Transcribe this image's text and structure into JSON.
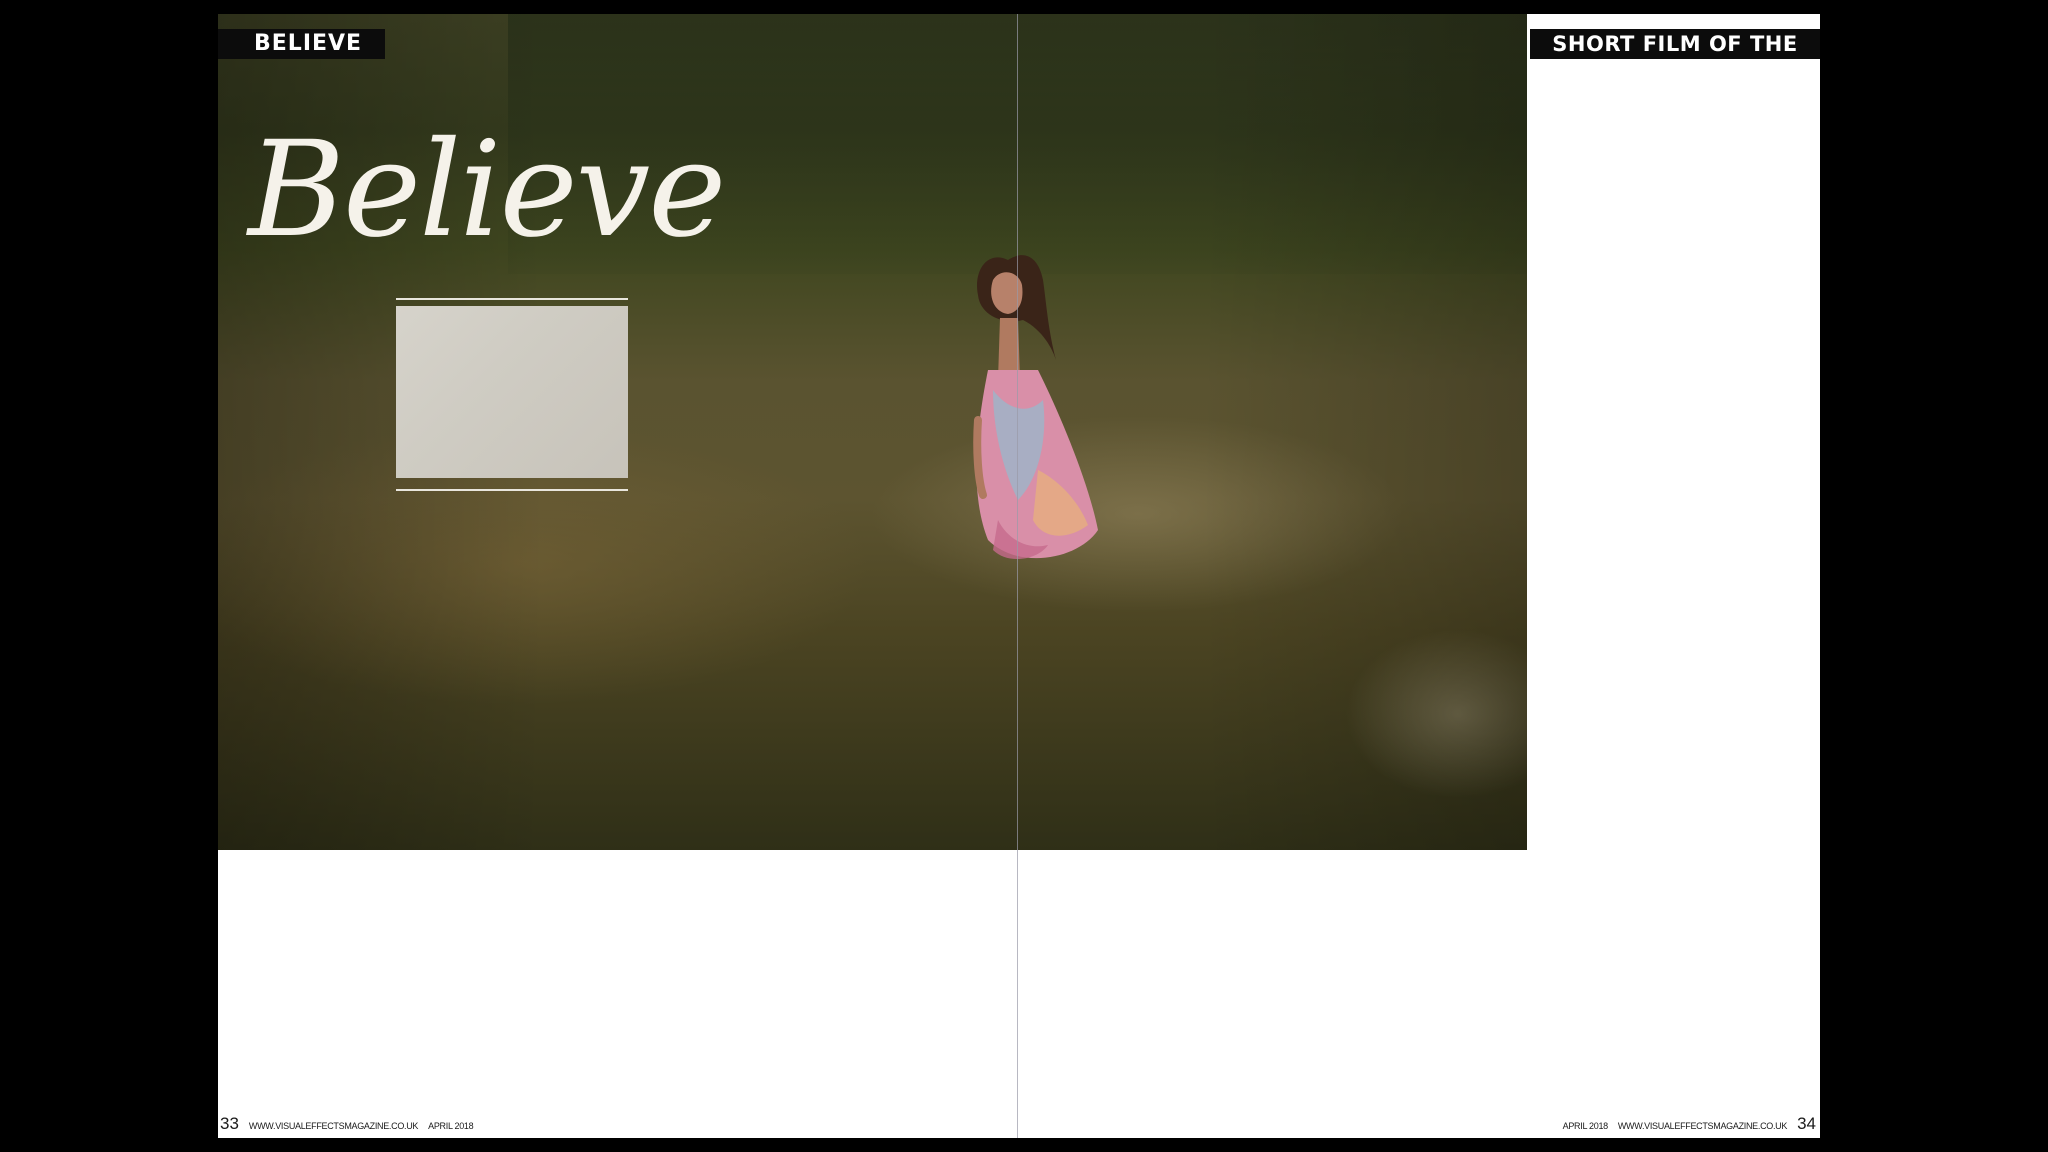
{
  "left_page": {
    "section_label": "BELIEVE",
    "script_title": "Believe",
    "page_number": "33",
    "footer_url": "WWW.VISUALEFFECTSMAGAZINE.CO.UK",
    "footer_date": "APRIL 2018"
  },
  "right_page": {
    "section_label": "SHORT FILM OF THE MONTH",
    "page_number": "34",
    "footer_url": "WWW.VISUALEFFECTSMAGAZINE.CO.UK",
    "footer_date": "APRIL 2018"
  },
  "colors": {
    "background": "#000000",
    "page": "#ffffff",
    "label_bg": "#0c0c0c",
    "label_text": "#ffffff"
  }
}
